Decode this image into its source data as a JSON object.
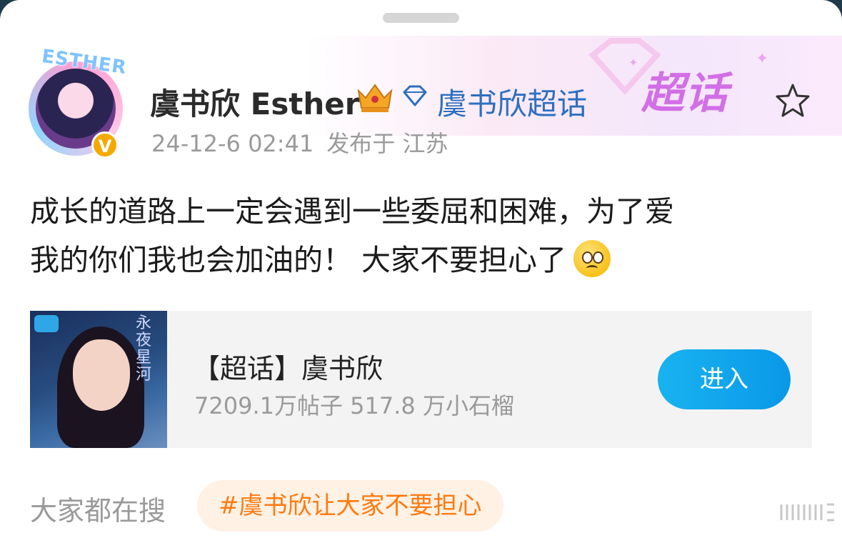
{
  "post": {
    "username": "虞书欣 Esther",
    "topic_link": "虞书欣超话",
    "timestamp": "24-12-6 02:41",
    "location": "发布于 江苏",
    "content_line1": "成长的道路上一定会遇到一些委屈和困难，为了爱",
    "content_line2": "我的你们我也会加油的！ 大家不要担心了"
  },
  "header_badge": {
    "text": "超话"
  },
  "avatar": {
    "label": "ESTHER",
    "verified_mark": "V"
  },
  "topic_card": {
    "title": "【超话】虞书欣",
    "stats": "7209.1万帖子 517.8 万小石榴",
    "enter_label": "进入",
    "cover_text": "永夜星河"
  },
  "footer": {
    "search_label": "大家都在搜",
    "hot_tag": "#虞书欣让大家不要担心"
  },
  "colors": {
    "link_blue": "#2d6fbf",
    "enter_button": "#0a98e8",
    "hot_tag_text": "#ff7a10",
    "badge_purple": "#d26fe6"
  },
  "icons": {
    "crown": "crown-icon",
    "diamond": "diamond-icon",
    "star": "star-icon",
    "emoji": "pleading-face-emoji",
    "more": "more-icon"
  }
}
